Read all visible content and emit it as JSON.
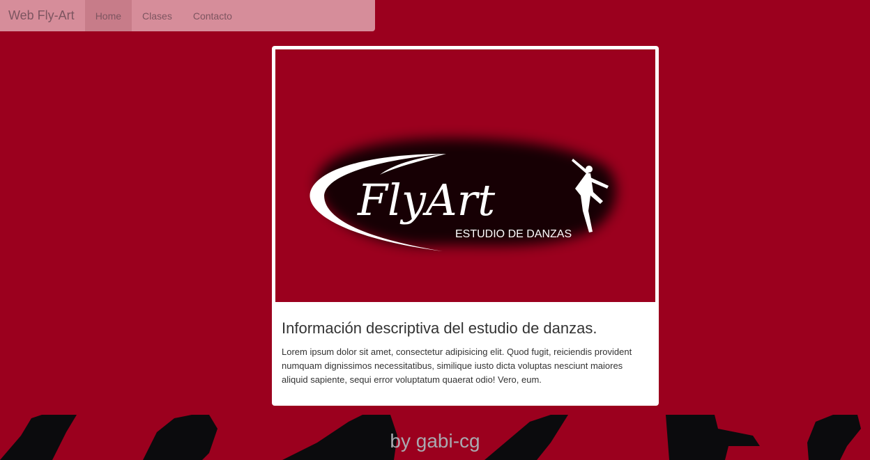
{
  "navbar": {
    "brand": "Web Fly-Art",
    "links": [
      {
        "label": "Home",
        "active": true
      },
      {
        "label": "Clases",
        "active": false
      },
      {
        "label": "Contacto",
        "active": false
      }
    ]
  },
  "card": {
    "logo": {
      "text": "FlyArt",
      "subtitle": "ESTUDIO DE DANZAS",
      "icon": "dancer-icon"
    },
    "title": "Información descriptiva del estudio de danzas.",
    "body": "Lorem ipsum dolor sit amet, consectetur adipisicing elit. Quod fugit, reiciendis provident numquam dignissimos necessitatibus, similique iusto dicta voluptas nesciunt maiores aliquid sapiente, sequi error voluptatum quaerat odio! Vero, eum."
  },
  "footer": {
    "text": "by gabi-cg"
  },
  "colors": {
    "background": "#9b001e",
    "navbar": "#d68d9a",
    "card": "#ffffff",
    "silhouette": "#0b0b0d"
  }
}
